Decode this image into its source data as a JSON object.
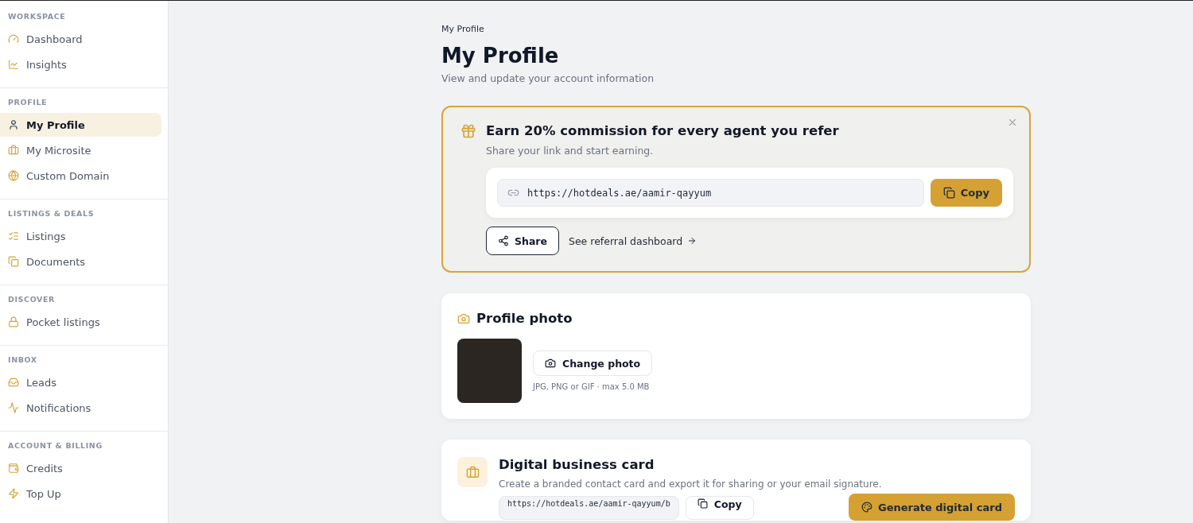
{
  "sidebar": {
    "sections": [
      {
        "heading": "WORKSPACE",
        "items": [
          {
            "label": "Dashboard",
            "selected": false
          },
          {
            "label": "Insights",
            "selected": false
          }
        ]
      },
      {
        "heading": "PROFILE",
        "items": [
          {
            "label": "My Profile",
            "selected": true
          },
          {
            "label": "My Microsite",
            "selected": false
          },
          {
            "label": "Custom Domain",
            "selected": false
          }
        ]
      },
      {
        "heading": "LISTINGS & DEALS",
        "items": [
          {
            "label": "Listings",
            "selected": false
          },
          {
            "label": "Documents",
            "selected": false
          }
        ]
      },
      {
        "heading": "DISCOVER",
        "items": [
          {
            "label": "Pocket listings",
            "selected": false
          }
        ]
      },
      {
        "heading": "INBOX",
        "items": [
          {
            "label": "Leads",
            "selected": false
          },
          {
            "label": "Notifications",
            "selected": false
          }
        ]
      },
      {
        "heading": "ACCOUNT & BILLING",
        "items": [
          {
            "label": "Credits",
            "selected": false
          },
          {
            "label": "Top Up",
            "selected": false
          }
        ]
      }
    ]
  },
  "breadcrumb": "My Profile",
  "title": "My Profile",
  "subtitle": "View and update your account information",
  "referral": {
    "title": "Earn 20% commission for every agent you refer",
    "subtitle": "Share your link and start earning.",
    "link": "https://hotdeals.ae/aamir-qayyum",
    "copy_label": "Copy",
    "share_label": "Share",
    "dashboard_link": "See referral dashboard"
  },
  "photo_card": {
    "title": "Profile photo",
    "button": "Change photo",
    "hint": "JPG, PNG or GIF · max 5.0 MB"
  },
  "business_card": {
    "title": "Digital business card",
    "description": "Create a branded contact card and export it for sharing or your email signature.",
    "link": "https://hotdeals.ae/aamir-qayyum/b",
    "copy_label": "Copy",
    "generate_label": "Generate digital card"
  }
}
